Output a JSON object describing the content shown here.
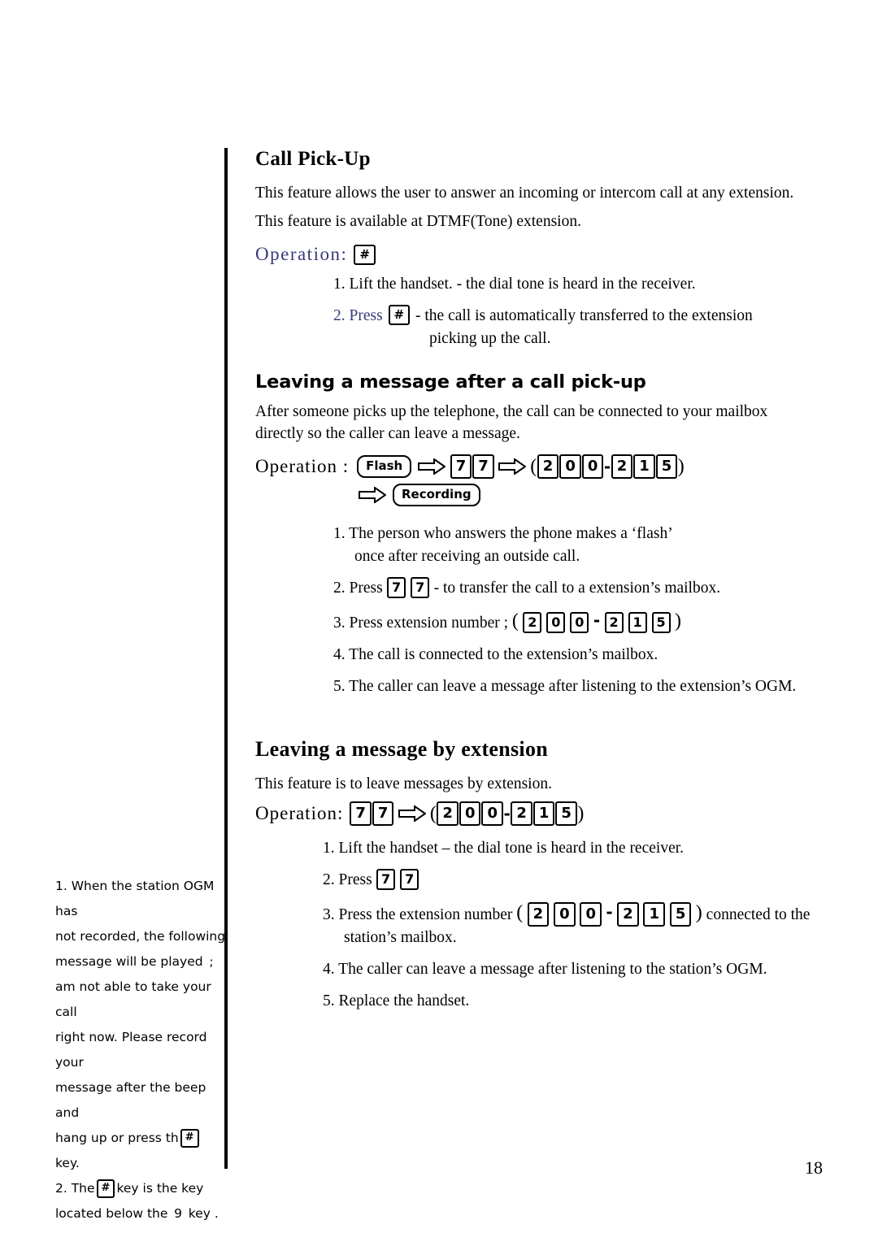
{
  "page": {
    "number": "18"
  },
  "section1": {
    "title": "Call Pick-Up",
    "para1": "This feature allows the user to answer an incoming or intercom call at any extension.",
    "para2": "This feature is available at DTMF(Tone) extension.",
    "operation_label": "Operation:",
    "operation_key": "#",
    "steps": [
      {
        "num": "1.",
        "text": "Lift the handset.  - the dial tone is heard in the receiver."
      },
      {
        "num": "2.",
        "press": "Press",
        "key": "#",
        "text": "- the call is automatically transferred to the extension",
        "text2": "picking up the call."
      }
    ]
  },
  "section2": {
    "title": "Leaving a message after a call pick-up",
    "para1": "After someone picks up the telephone, the call can be connected to your mailbox directly so the caller can leave a message.",
    "operation_label": "Operation :",
    "operation_flash": "Flash",
    "operation_77": [
      "7",
      "7"
    ],
    "operation_ext": [
      "2",
      "0",
      "0",
      "-",
      "2",
      "1",
      "5"
    ],
    "operation_recording": "Recording",
    "steps": [
      {
        "num": "1.",
        "text": "The person who answers the phone makes a ‘flash’",
        "text2": "once after receiving an outside call."
      },
      {
        "num": "2.",
        "press": "Press",
        "keys": [
          "7",
          "7"
        ],
        "text": "- to transfer the call to a extension’s mailbox."
      },
      {
        "num": "3.",
        "text": "Press extension number ;",
        "keys": [
          "2",
          "0",
          "0",
          "-",
          "2",
          "1",
          "5"
        ]
      },
      {
        "num": "4.",
        "text": "The call is connected to the extension’s mailbox."
      },
      {
        "num": "5.",
        "text": "The caller can leave a message after listening to the extension’s OGM."
      }
    ]
  },
  "section3": {
    "title": "Leaving a message by extension",
    "para1": "This feature is to leave messages by extension.",
    "operation_label": "Operation:",
    "operation_77": [
      "7",
      "7"
    ],
    "operation_ext": [
      "2",
      "0",
      "0",
      "-",
      "2",
      "1",
      "5"
    ],
    "steps": [
      {
        "num": "1.",
        "text": "Lift the handset – the dial tone is heard in the receiver."
      },
      {
        "num": "2.",
        "press": "Press",
        "keys": [
          "7",
          "7"
        ]
      },
      {
        "num": "3.",
        "text": "Press the extension number",
        "keys": [
          "2",
          "0",
          "0",
          "-",
          "2",
          "1",
          "5"
        ],
        "text_after": "connected to the",
        "text2": "station’s mailbox."
      },
      {
        "num": "4.",
        "text": "The caller can leave a message after listening to the station’s OGM."
      },
      {
        "num": "5.",
        "text": "Replace the handset."
      }
    ]
  },
  "note": {
    "line1": "1. When the station OGM has",
    "line2": "not recorded, the following",
    "line3": "message will be played ;  I",
    "line4": "am not able to take your call",
    "line5": "right now.  Please record your",
    "line6": "message after the beep and",
    "line7_a": "hang up or press th",
    "line7_key": "#",
    "line8": "key.",
    "line9_a": "2. The",
    "line9_key": "#",
    "line9_b": "key is the key",
    "line10": "located below the 9 key ."
  }
}
